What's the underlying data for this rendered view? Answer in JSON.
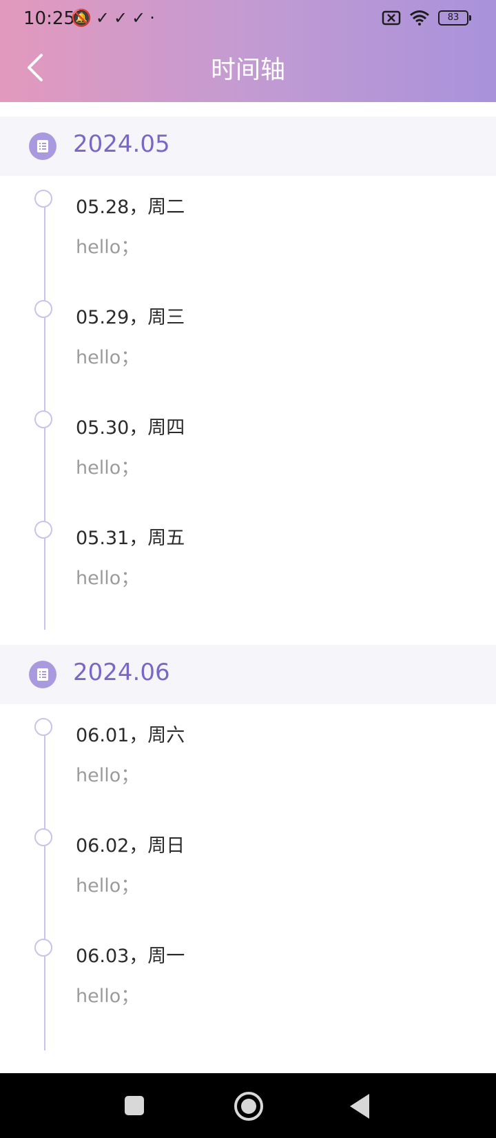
{
  "status_bar": {
    "time": "10:25",
    "left_icons": "🔕✓✓✓·",
    "battery": "83"
  },
  "header": {
    "title": "时间轴"
  },
  "months": [
    {
      "label": "2024.05",
      "entries": [
        {
          "day": "05.28，周二",
          "note": "hello；"
        },
        {
          "day": "05.29，周三",
          "note": "hello；"
        },
        {
          "day": "05.30，周四",
          "note": "hello；"
        },
        {
          "day": "05.31，周五",
          "note": "hello；"
        }
      ]
    },
    {
      "label": "2024.06",
      "entries": [
        {
          "day": "06.01，周六",
          "note": "hello；"
        },
        {
          "day": "06.02，周日",
          "note": "hello；"
        },
        {
          "day": "06.03，周一",
          "note": "hello；"
        }
      ]
    }
  ],
  "colors": {
    "accent": "#7a66c7",
    "timeline": "#c9c2ee",
    "header_start": "#e399bd",
    "header_end": "#a992db"
  }
}
